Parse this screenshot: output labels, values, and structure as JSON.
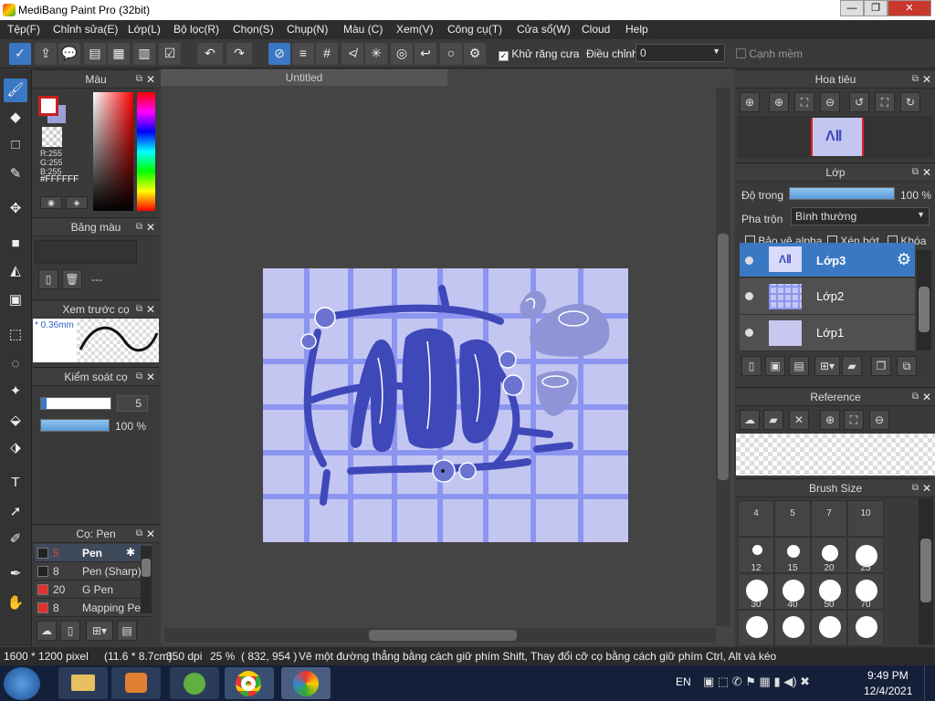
{
  "window": {
    "title": "MediBang Paint Pro (32bit)",
    "minimize": "—",
    "restore": "❐",
    "close": "✕"
  },
  "menu": [
    "Tệp(F)",
    "Chỉnh sửa(E)",
    "Lớp(L)",
    "Bộ lọc(R)",
    "Chọn(S)",
    "Chụp(N)",
    "Màu (C)",
    "Xem(V)",
    "Công cụ(T)",
    "Cửa sổ(W)",
    "Cloud",
    "Help"
  ],
  "toolbar": {
    "antialias_label": "Khử răng cưa",
    "correction_label": "Điều chỉnh",
    "correction_value": "0",
    "soft_edge_label": "Cạnh mềm"
  },
  "color_panel": {
    "title": "Màu",
    "r": "R:255",
    "g": "G:255",
    "b": "B:255",
    "hex": "#FFFFFF"
  },
  "palette_panel": {
    "title": "Bảng màu",
    "count": "---"
  },
  "brush_preview_panel": {
    "title": "Xem trước cọ",
    "size_label": "* 0.36mm"
  },
  "brush_control_panel": {
    "title": "Kiểm soát cọ",
    "size_value": "5",
    "opacity_value": "100 %",
    "size_fraction": 0.08,
    "opacity_fraction": 1.0
  },
  "brush_list_panel": {
    "title": "Cọ: Pen",
    "items": [
      {
        "size": "5",
        "name": "Pen",
        "color": "#222222"
      },
      {
        "size": "8",
        "name": "Pen (Sharp)",
        "color": "#222222"
      },
      {
        "size": "20",
        "name": "G Pen",
        "color": "#e03030"
      },
      {
        "size": "8",
        "name": "Mapping Pen",
        "color": "#e03030"
      }
    ]
  },
  "document": {
    "tab": "Untitled"
  },
  "navigator_panel": {
    "title": "Hoa tiêu"
  },
  "layer_panel": {
    "title": "Lớp",
    "opacity_label": "Độ trong",
    "opacity_value": "100 %",
    "opacity_fraction": 1.0,
    "blend_label": "Pha trộn",
    "blend_value": "Bình thường",
    "protect_alpha": "Bảo vệ alpha",
    "clipping": "Xén bớt",
    "lock": "Khóa",
    "layers": [
      {
        "name": "Lớp3",
        "selected": true
      },
      {
        "name": "Lớp2",
        "selected": false
      },
      {
        "name": "Lớp1",
        "selected": false
      }
    ]
  },
  "reference_panel": {
    "title": "Reference"
  },
  "brush_size_panel": {
    "title": "Brush Size",
    "sizes": [
      "4",
      "5",
      "7",
      "10",
      "12",
      "15",
      "20",
      "25",
      "30",
      "40",
      "50",
      "70"
    ]
  },
  "status": {
    "dimensions": "1600 * 1200 pixel",
    "physical": "(11.6 * 8.7cm)",
    "dpi": "350 dpi",
    "zoom": "25 %",
    "coords": "( 832, 954 )",
    "hint": "Vẽ một đường thẳng bằng cách giữ phím Shift, Thay đổi cỡ cọ bằng cách giữ phím Ctrl, Alt và kéo"
  },
  "taskbar": {
    "lang": "EN",
    "time": "9:49 PM",
    "date": "12/4/2021"
  }
}
